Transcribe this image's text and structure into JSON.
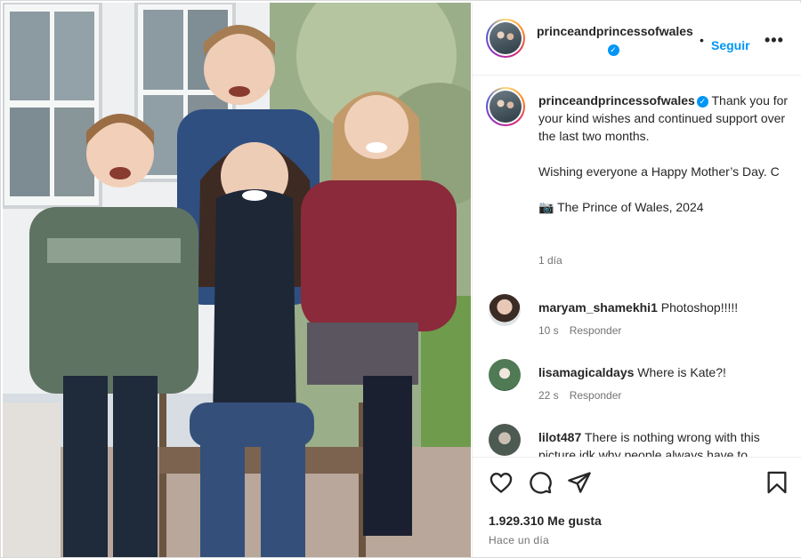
{
  "header": {
    "username": "princeandprincessofwales",
    "follow_label": "Seguir",
    "more_label": "•••",
    "separator": "•"
  },
  "caption": {
    "username": "princeandprincessofwales",
    "line1": "Thank you for your kind wishes and continued support over the last two months.",
    "line2": "Wishing everyone a Happy Mother’s Day. C",
    "credit_icon": "📷",
    "credit": "The Prince of Wales, 2024",
    "time": "1 día"
  },
  "comments": [
    {
      "username": "maryam_shamekhi1",
      "text": "Photoshop!!!!!",
      "time": "10 s",
      "reply_label": "Responder"
    },
    {
      "username": "lisamagicaldays",
      "text": "Where is Kate?!",
      "time": "22 s",
      "reply_label": "Responder"
    },
    {
      "username": "lilot487",
      "text": "There is nothing wrong with this picture idk why people always have to",
      "time": "",
      "reply_label": ""
    }
  ],
  "actions": {
    "icons": [
      "heart-icon",
      "comment-icon",
      "share-icon",
      "bookmark-icon"
    ],
    "likes": "1.929.310 Me gusta",
    "post_time": "Hace un día"
  },
  "colors": {
    "accent": "#0095f6",
    "text": "#262626",
    "muted": "#737373",
    "border": "#dbdbdb"
  }
}
